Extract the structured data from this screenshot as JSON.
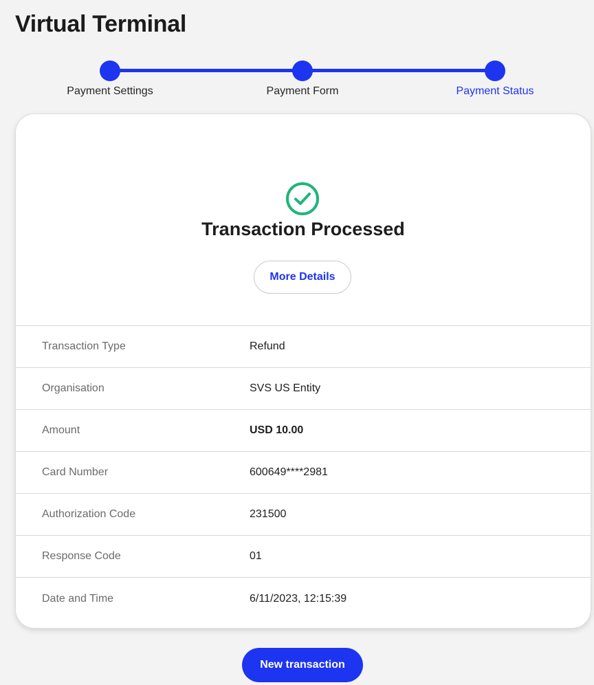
{
  "page": {
    "title": "Virtual Terminal"
  },
  "stepper": {
    "steps": [
      {
        "label": "Payment Settings",
        "state": "complete"
      },
      {
        "label": "Payment Form",
        "state": "complete"
      },
      {
        "label": "Payment Status",
        "state": "active"
      }
    ]
  },
  "status": {
    "icon": "check-circle-icon",
    "title": "Transaction Processed",
    "more_details_label": "More Details"
  },
  "details": [
    {
      "label": "Transaction Type",
      "value": "Refund"
    },
    {
      "label": "Organisation",
      "value": "SVS US Entity"
    },
    {
      "label": "Amount",
      "value": "USD 10.00",
      "emphasis": true
    },
    {
      "label": "Card Number",
      "value": "600649****2981"
    },
    {
      "label": "Authorization Code",
      "value": "231500"
    },
    {
      "label": "Response Code",
      "value": "01"
    },
    {
      "label": "Date and Time",
      "value": "6/11/2023, 12:15:39"
    }
  ],
  "actions": {
    "new_transaction_label": "New transaction"
  },
  "colors": {
    "accent": "#1d34f0",
    "success": "#1fb57a",
    "background": "#f3f3f4"
  }
}
